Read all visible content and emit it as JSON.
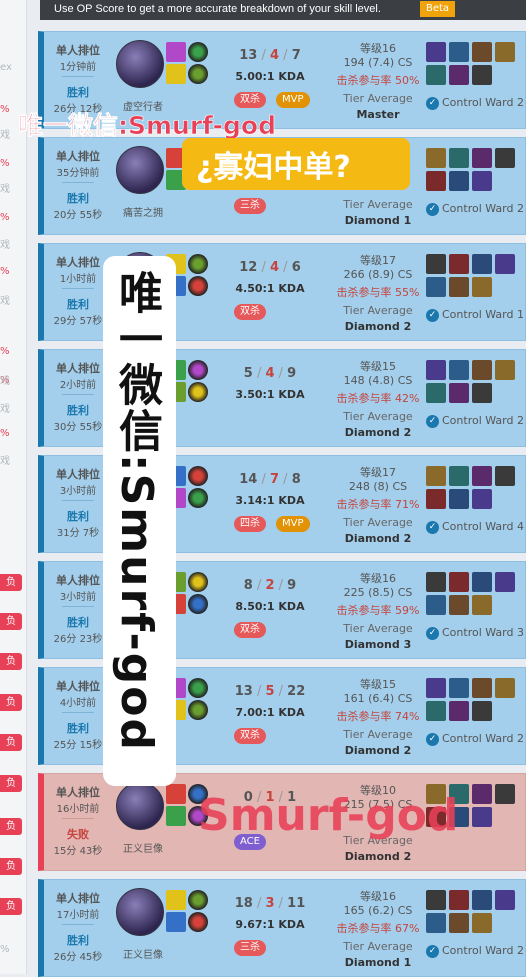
{
  "banner": {
    "text": "Use OP Score to get a more accurate breakdown of your skill level.",
    "beta": "Beta"
  },
  "sidebar": {
    "ex": "ex",
    "pct_markers": [
      "%",
      "%",
      "%",
      "%",
      "%",
      "%",
      "%"
    ],
    "game_markers": [
      "戏",
      "戏",
      "戏",
      "戏",
      "戏",
      "戏",
      "戏"
    ],
    "loss_tags": [
      "负",
      "负",
      "负",
      "负",
      "负",
      "负",
      "负",
      "负",
      "负"
    ],
    "bottom_pct": "%"
  },
  "games": [
    {
      "queue": "单人排位",
      "time": "1分钟前",
      "result": "胜利",
      "length": "26分 12秒",
      "champion": "虚空行者",
      "k": "13",
      "d": "4",
      "a": "7",
      "ratio": "5.00:1 KDA",
      "badges": [
        "双杀",
        "MVP"
      ],
      "level": "等级16",
      "cs": "194 (7.4) CS",
      "kp": "击杀参与率 50%",
      "tier_label": "Tier Average",
      "tier": "Master",
      "ward": "Control Ward 2"
    },
    {
      "queue": "单人排位",
      "time": "35分钟前",
      "result": "胜利",
      "length": "20分 55秒",
      "champion": "痛苦之拥",
      "k": "",
      "d": "",
      "a": "",
      "ratio": "",
      "badges": [
        "三杀"
      ],
      "level": "",
      "cs": "",
      "kp": "",
      "tier_label": "Tier Average",
      "tier": "Diamond 1",
      "ward": "Control Ward 2"
    },
    {
      "queue": "单人排位",
      "time": "1小时前",
      "result": "胜利",
      "length": "29分 57秒",
      "champion": "",
      "k": "12",
      "d": "4",
      "a": "6",
      "ratio": "4.50:1 KDA",
      "badges": [
        "双杀"
      ],
      "level": "等级17",
      "cs": "266 (8.9) CS",
      "kp": "击杀参与率 55%",
      "tier_label": "Tier Average",
      "tier": "Diamond 2",
      "ward": "Control Ward 1"
    },
    {
      "queue": "单人排位",
      "time": "2小时前",
      "result": "胜利",
      "length": "30分 55秒",
      "champion": "",
      "k": "5",
      "d": "4",
      "a": "9",
      "ratio": "3.50:1 KDA",
      "badges": [],
      "level": "等级15",
      "cs": "148 (4.8) CS",
      "kp": "击杀参与率 42%",
      "tier_label": "Tier Average",
      "tier": "Diamond 2",
      "ward": "Control Ward 2"
    },
    {
      "queue": "单人排位",
      "time": "3小时前",
      "result": "胜利",
      "length": "31分 7秒",
      "champion": "",
      "k": "14",
      "d": "7",
      "a": "8",
      "ratio": "3.14:1 KDA",
      "badges": [
        "四杀",
        "MVP"
      ],
      "level": "等级17",
      "cs": "248 (8) CS",
      "kp": "击杀参与率 71%",
      "tier_label": "Tier Average",
      "tier": "Diamond 2",
      "ward": "Control Ward 4"
    },
    {
      "queue": "单人排位",
      "time": "3小时前",
      "result": "胜利",
      "length": "26分 23秒",
      "champion": "",
      "k": "8",
      "d": "2",
      "a": "9",
      "ratio": "8.50:1 KDA",
      "badges": [
        "双杀"
      ],
      "level": "等级16",
      "cs": "225 (8.5) CS",
      "kp": "击杀参与率 59%",
      "tier_label": "Tier Average",
      "tier": "Diamond 3",
      "ward": "Control Ward 3"
    },
    {
      "queue": "单人排位",
      "time": "4小时前",
      "result": "胜利",
      "length": "25分 15秒",
      "champion": "",
      "k": "13",
      "d": "5",
      "a": "22",
      "ratio": "7.00:1 KDA",
      "badges": [
        "双杀"
      ],
      "level": "等级15",
      "cs": "161 (6.4) CS",
      "kp": "击杀参与率 74%",
      "tier_label": "Tier Average",
      "tier": "Diamond 2",
      "ward": "Control Ward 2"
    },
    {
      "queue": "单人排位",
      "time": "16小时前",
      "result": "失败",
      "length": "15分 43秒",
      "champion": "正义巨像",
      "k": "0",
      "d": "1",
      "a": "1",
      "ratio": "",
      "badges": [
        "ACE"
      ],
      "level": "等级10",
      "cs": "215 (7.5) CS",
      "kp": "",
      "tier_label": "Tier Average",
      "tier": "Diamond 2",
      "ward": ""
    },
    {
      "queue": "单人排位",
      "time": "17小时前",
      "result": "胜利",
      "length": "26分 45秒",
      "champion": "正义巨像",
      "k": "18",
      "d": "3",
      "a": "11",
      "ratio": "9.67:1 KDA",
      "badges": [
        "三杀"
      ],
      "level": "等级16",
      "cs": "165 (6.2) CS",
      "kp": "击杀参与率 67%",
      "tier_label": "Tier Average",
      "tier": "Diamond 1",
      "ward": "Control Ward 2"
    }
  ],
  "overlays": {
    "watermark_top": "唯一微信:Smurf-god",
    "question": "¿寡妇中单?",
    "vertical": "唯一微信:Smurf-god",
    "watermark_bottom": "Smurf-god"
  },
  "colors": {
    "win_bg": "#a3cfec",
    "win_accent": "#1a78ae",
    "loss_bg": "#e2b6b3",
    "loss_accent": "#e84057",
    "question_box": "#f5b914"
  }
}
